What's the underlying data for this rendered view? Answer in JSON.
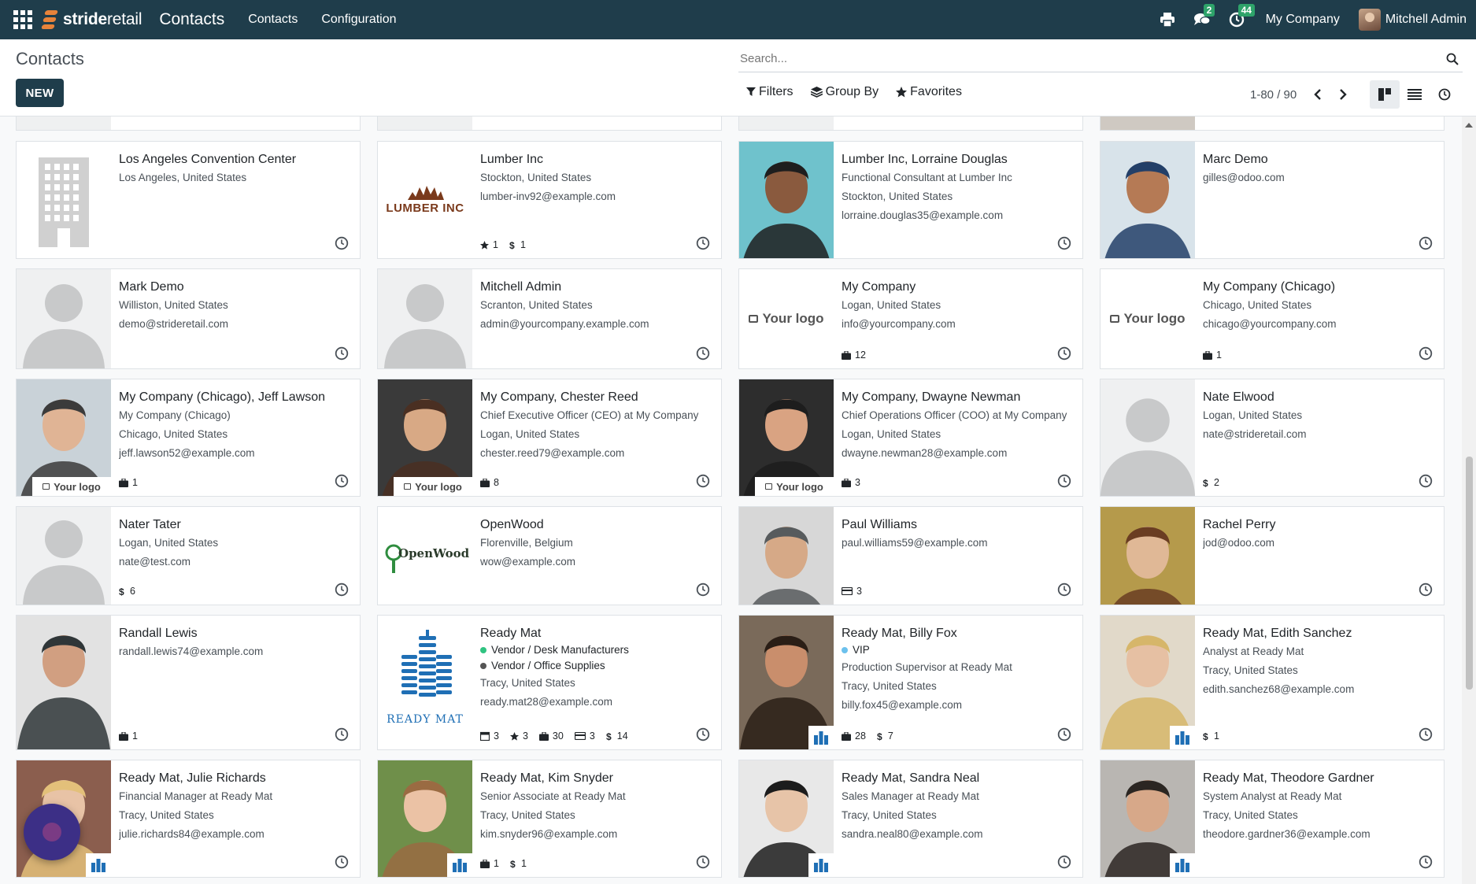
{
  "navbar": {
    "brand_bold": "stride",
    "brand_light": "retail",
    "module": "Contacts",
    "menu": [
      "Contacts",
      "Configuration"
    ],
    "messages_count": "2",
    "activities_count": "44",
    "company": "My Company",
    "user": "Mitchell Admin"
  },
  "control": {
    "breadcrumb": "Contacts",
    "new_label": "NEW",
    "search_placeholder": "Search...",
    "filters_label": "Filters",
    "groupby_label": "Group By",
    "favorites_label": "Favorites",
    "pager": "1-80 / 90"
  },
  "colors": {
    "navbar": "#1f3d4b",
    "accent": "#e8833a",
    "badge": "#2ea36a"
  },
  "cards": [
    {
      "name": "Los Angeles Convention Center",
      "lines": [
        "Los Angeles, United States"
      ],
      "tags": [],
      "stats": [],
      "avatar": "building-icon"
    },
    {
      "name": "Lumber Inc",
      "lines": [
        "Stockton, United States",
        "lumber-inv92@example.com"
      ],
      "tags": [],
      "stats": [
        {
          "icon": "star-icon",
          "value": "1"
        },
        {
          "icon": "dollar-icon",
          "value": "1"
        }
      ],
      "avatar": "lumber-logo",
      "logo_text": "LUMBER INC"
    },
    {
      "name": "Lumber Inc, Lorraine Douglas",
      "lines": [
        "Functional Consultant at Lumber Inc",
        "Stockton, United States",
        "lorraine.douglas35@example.com"
      ],
      "tags": [],
      "stats": [],
      "avatar": "photo-teal"
    },
    {
      "name": "Marc Demo",
      "lines": [
        "gilles@odoo.com"
      ],
      "tags": [],
      "stats": [],
      "avatar": "photo-a"
    },
    {
      "name": "Mark Demo",
      "lines": [
        "Williston, United States",
        "demo@strideretail.com"
      ],
      "tags": [],
      "stats": [],
      "avatar": "silhouette"
    },
    {
      "name": "Mitchell Admin",
      "lines": [
        "Scranton, United States",
        "admin@yourcompany.example.com"
      ],
      "tags": [],
      "stats": [],
      "avatar": "silhouette"
    },
    {
      "name": "My Company",
      "lines": [
        "Logan, United States",
        "info@yourcompany.com"
      ],
      "tags": [],
      "stats": [
        {
          "icon": "case-icon",
          "value": "12"
        }
      ],
      "avatar": "your-logo",
      "logo_text": "Your logo"
    },
    {
      "name": "My Company (Chicago)",
      "lines": [
        "Chicago, United States",
        "chicago@yourcompany.com"
      ],
      "tags": [],
      "stats": [
        {
          "icon": "case-icon",
          "value": "1"
        }
      ],
      "avatar": "your-logo",
      "logo_text": "Your logo"
    },
    {
      "name": "My Company (Chicago), Jeff Lawson",
      "lines": [
        "My Company (Chicago)",
        "Chicago, United States",
        "jeff.lawson52@example.com"
      ],
      "tags": [],
      "stats": [
        {
          "icon": "case-icon",
          "value": "1"
        }
      ],
      "avatar": "photo-b",
      "mini_logo": "Your logo"
    },
    {
      "name": "My Company, Chester Reed",
      "lines": [
        "Chief Executive Officer (CEO) at My Company",
        "Logan, United States",
        "chester.reed79@example.com"
      ],
      "tags": [],
      "stats": [
        {
          "icon": "case-icon",
          "value": "8"
        }
      ],
      "avatar": "photo-c",
      "mini_logo": "Your logo"
    },
    {
      "name": "My Company, Dwayne Newman",
      "lines": [
        "Chief Operations Officer (COO) at My Company",
        "Logan, United States",
        "dwayne.newman28@example.com"
      ],
      "tags": [],
      "stats": [
        {
          "icon": "case-icon",
          "value": "3"
        }
      ],
      "avatar": "photo-d",
      "mini_logo": "Your logo"
    },
    {
      "name": "Nate Elwood",
      "lines": [
        "Logan, United States",
        "nate@strideretail.com"
      ],
      "tags": [],
      "stats": [
        {
          "icon": "dollar-icon",
          "value": "2"
        }
      ],
      "avatar": "silhouette"
    },
    {
      "name": "Nater Tater",
      "lines": [
        "Logan, United States",
        "nate@test.com"
      ],
      "tags": [],
      "stats": [
        {
          "icon": "dollar-icon",
          "value": "6"
        }
      ],
      "avatar": "silhouette"
    },
    {
      "name": "OpenWood",
      "lines": [
        "Florenville, Belgium",
        "wow@example.com"
      ],
      "tags": [],
      "stats": [],
      "avatar": "openwood-logo",
      "logo_text": "OpenWood"
    },
    {
      "name": "Paul Williams",
      "lines": [
        "paul.williams59@example.com"
      ],
      "tags": [],
      "stats": [
        {
          "icon": "card-icon",
          "value": "3"
        }
      ],
      "avatar": "photo-e"
    },
    {
      "name": "Rachel Perry",
      "lines": [
        "jod@odoo.com"
      ],
      "tags": [],
      "stats": [],
      "avatar": "photo-f"
    },
    {
      "name": "Randall Lewis",
      "lines": [
        "randall.lewis74@example.com"
      ],
      "tags": [],
      "stats": [
        {
          "icon": "case-icon",
          "value": "1"
        }
      ],
      "avatar": "photo-g"
    },
    {
      "name": "Ready Mat",
      "lines": [
        "Tracy, United States",
        "ready.mat28@example.com"
      ],
      "tags": [
        {
          "label": "Vendor / Desk Manufacturers",
          "color": "#30c381"
        },
        {
          "label": "Vendor / Office Supplies",
          "color": "#555555"
        }
      ],
      "stats": [
        {
          "icon": "calendar-icon",
          "value": "3"
        },
        {
          "icon": "star-icon",
          "value": "3"
        },
        {
          "icon": "case-icon",
          "value": "30"
        },
        {
          "icon": "card-icon",
          "value": "3"
        },
        {
          "icon": "dollar-icon",
          "value": "14"
        }
      ],
      "avatar": "readymat-logo",
      "logo_text": "READY MAT"
    },
    {
      "name": "Ready Mat, Billy Fox",
      "lines": [
        "Production Supervisor at Ready Mat",
        "Tracy, United States",
        "billy.fox45@example.com"
      ],
      "tags": [
        {
          "label": "VIP",
          "color": "#6cc1ed"
        }
      ],
      "stats": [
        {
          "icon": "case-icon",
          "value": "28"
        },
        {
          "icon": "dollar-icon",
          "value": "7"
        }
      ],
      "avatar": "photo-h",
      "comp_badge": true
    },
    {
      "name": "Ready Mat, Edith Sanchez",
      "lines": [
        "Analyst at Ready Mat",
        "Tracy, United States",
        "edith.sanchez68@example.com"
      ],
      "tags": [],
      "stats": [
        {
          "icon": "dollar-icon",
          "value": "1"
        }
      ],
      "avatar": "photo-i",
      "comp_badge": true
    },
    {
      "name": "Ready Mat, Julie Richards",
      "lines": [
        "Financial Manager at Ready Mat",
        "Tracy, United States",
        "julie.richards84@example.com"
      ],
      "tags": [],
      "stats": [],
      "avatar": "photo-j",
      "comp_badge": true
    },
    {
      "name": "Ready Mat, Kim Snyder",
      "lines": [
        "Senior Associate at Ready Mat",
        "Tracy, United States",
        "kim.snyder96@example.com"
      ],
      "tags": [],
      "stats": [
        {
          "icon": "case-icon",
          "value": "1"
        },
        {
          "icon": "dollar-icon",
          "value": "1"
        }
      ],
      "avatar": "photo-k",
      "comp_badge": true
    },
    {
      "name": "Ready Mat, Sandra Neal",
      "lines": [
        "Sales Manager at Ready Mat",
        "Tracy, United States",
        "sandra.neal80@example.com"
      ],
      "tags": [],
      "stats": [],
      "avatar": "photo-l",
      "comp_badge": true
    },
    {
      "name": "Ready Mat, Theodore Gardner",
      "lines": [
        "System Analyst at Ready Mat",
        "Tracy, United States",
        "theodore.gardner36@example.com"
      ],
      "tags": [],
      "stats": [],
      "avatar": "photo-m",
      "comp_badge": true
    }
  ]
}
